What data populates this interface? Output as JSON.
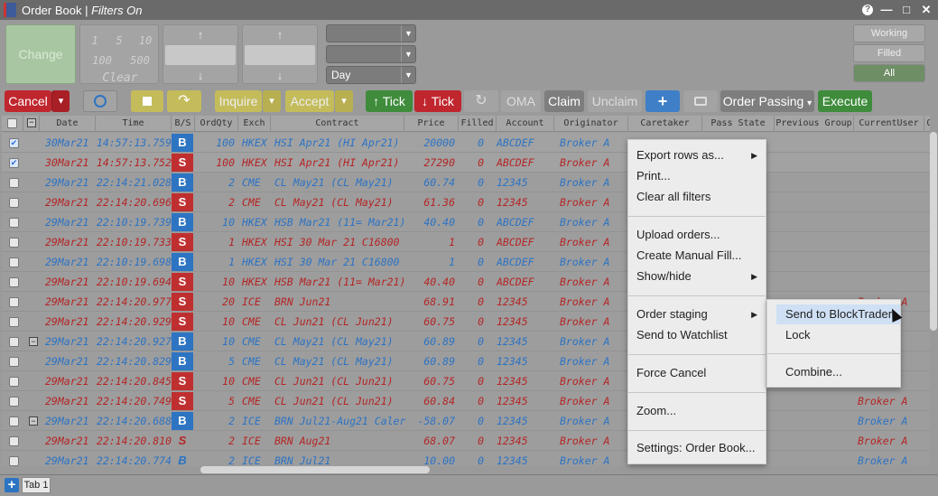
{
  "window": {
    "title_main": "Order Book | ",
    "title_italic": "Filters On",
    "buttons": [
      "?",
      "—",
      "□",
      "✕"
    ]
  },
  "toolbar": {
    "change_label": "Change",
    "qty_row1": [
      "1",
      "5",
      "10"
    ],
    "qty_row2": [
      "100",
      "500"
    ],
    "clear_label": "Clear",
    "up_arrow": "↑",
    "down_arrow": "↓",
    "dropdowns": [
      "",
      "",
      "Day"
    ],
    "caret": "▼",
    "right_tabs": [
      "Working",
      "Filled",
      "All"
    ]
  },
  "actions": {
    "cancel": "Cancel",
    "cancel_caret": "▾",
    "inquire": "Inquire",
    "accept": "Accept",
    "buy_tick": "↑ Tick",
    "sell_tick": "↓ Tick",
    "oma": "OMA",
    "claim": "Claim",
    "unclaim": "Unclaim",
    "plus": "+",
    "order_passing": "Order Passing",
    "execute": "Execute",
    "colors": {
      "cancel": "#c0262e",
      "buy": "#3f8c3c",
      "sell": "#c0262e",
      "execute": "#3f8c3c",
      "plus": "#2d74c2"
    }
  },
  "grid": {
    "headers": [
      "Date",
      "Time",
      "B/S",
      "OrdQty",
      "Exch",
      "Contract",
      "Price",
      "Filled",
      "Account",
      "Originator",
      "Caretaker",
      "Pass State",
      "Previous Group",
      "CurrentUser",
      "Or"
    ],
    "rows": [
      {
        "date": "30Mar21",
        "time": "14:57:13.759",
        "bs": "B",
        "qty": "100",
        "exch": "HKEX",
        "contract": "HSI Apr21 (HI Apr21)",
        "price": "20000",
        "filled": "0",
        "account": "ABCDEF",
        "orig": "Broker A",
        "current": "",
        "checked": true,
        "sel": true
      },
      {
        "date": "30Mar21",
        "time": "14:57:13.752",
        "bs": "S",
        "qty": "100",
        "exch": "HKEX",
        "contract": "HSI Apr21 (HI Apr21)",
        "price": "27290",
        "filled": "0",
        "account": "ABCDEF",
        "orig": "Broker A",
        "current": "",
        "checked": true,
        "sel": true
      },
      {
        "date": "29Mar21",
        "time": "22:14:21.028",
        "bs": "B",
        "qty": "2",
        "exch": "CME",
        "contract": "CL May21 (CL May21)",
        "price": "60.74",
        "filled": "0",
        "account": "12345",
        "orig": "Broker A",
        "current": "",
        "checked": false
      },
      {
        "date": "29Mar21",
        "time": "22:14:20.696",
        "bs": "S",
        "qty": "2",
        "exch": "CME",
        "contract": "CL May21 (CL May21)",
        "price": "61.36",
        "filled": "0",
        "account": "12345",
        "orig": "Broker A",
        "current": "",
        "checked": false
      },
      {
        "date": "29Mar21",
        "time": "22:10:19.739",
        "bs": "B",
        "qty": "10",
        "exch": "HKEX",
        "contract": "HSB Mar21 (11= Mar21)",
        "price": "40.40",
        "filled": "0",
        "account": "ABCDEF",
        "orig": "Broker A",
        "current": "",
        "checked": false
      },
      {
        "date": "29Mar21",
        "time": "22:10:19.733",
        "bs": "S",
        "qty": "1",
        "exch": "HKEX",
        "contract": "HSI 30 Mar 21 C16800",
        "price": "1",
        "filled": "0",
        "account": "ABCDEF",
        "orig": "Broker A",
        "current": "",
        "checked": false
      },
      {
        "date": "29Mar21",
        "time": "22:10:19.698",
        "bs": "B",
        "qty": "1",
        "exch": "HKEX",
        "contract": "HSI 30 Mar 21 C16800",
        "price": "1",
        "filled": "0",
        "account": "ABCDEF",
        "orig": "Broker A",
        "current": "",
        "checked": false
      },
      {
        "date": "29Mar21",
        "time": "22:10:19.694",
        "bs": "S",
        "qty": "10",
        "exch": "HKEX",
        "contract": "HSB Mar21 (11= Mar21)",
        "price": "40.40",
        "filled": "0",
        "account": "ABCDEF",
        "orig": "Broker A",
        "current": "",
        "checked": false
      },
      {
        "date": "29Mar21",
        "time": "22:14:20.977",
        "bs": "S",
        "qty": "20",
        "exch": "ICE",
        "contract": "BRN Jun21",
        "price": "68.91",
        "filled": "0",
        "account": "12345",
        "orig": "Broker A",
        "current": "",
        "checked": false
      },
      {
        "date": "29Mar21",
        "time": "22:14:20.929",
        "bs": "S",
        "qty": "10",
        "exch": "CME",
        "contract": "CL Jun21 (CL Jun21)",
        "price": "60.75",
        "filled": "0",
        "account": "12345",
        "orig": "Broker A",
        "current": "",
        "checked": false
      },
      {
        "date": "29Mar21",
        "time": "22:14:20.927",
        "bs": "B",
        "qty": "10",
        "exch": "CME",
        "contract": "CL May21 (CL May21)",
        "price": "60.89",
        "filled": "0",
        "account": "12345",
        "orig": "Broker A",
        "current": "",
        "checked": false,
        "expander": true
      },
      {
        "date": "29Mar21",
        "time": "22:14:20.829",
        "bs": "B",
        "qty": "5",
        "exch": "CME",
        "contract": "CL May21 (CL May21)",
        "price": "60.89",
        "filled": "0",
        "account": "12345",
        "orig": "Broker A",
        "current": "",
        "checked": false
      },
      {
        "date": "29Mar21",
        "time": "22:14:20.845",
        "bs": "S",
        "qty": "10",
        "exch": "CME",
        "contract": "CL Jun21 (CL Jun21)",
        "price": "60.75",
        "filled": "0",
        "account": "12345",
        "orig": "Broker A",
        "current": "",
        "checked": false
      },
      {
        "date": "29Mar21",
        "time": "22:14:20.749",
        "bs": "S",
        "qty": "5",
        "exch": "CME",
        "contract": "CL Jun21 (CL Jun21)",
        "price": "60.84",
        "filled": "0",
        "account": "12345",
        "orig": "Broker A",
        "current": "Broker A",
        "checked": false
      },
      {
        "date": "29Mar21",
        "time": "22:14:20.688",
        "bs": "B",
        "qty": "2",
        "exch": "ICE",
        "contract": "BRN Jul21-Aug21 Caler",
        "price": "-58.07",
        "filled": "0",
        "account": "12345",
        "orig": "Broker A",
        "current": "Broker A",
        "checked": false,
        "expander": true
      },
      {
        "date": "29Mar21",
        "time": "22:14:20.810",
        "bs": "S",
        "qty": "2",
        "exch": "ICE",
        "contract": "BRN Aug21",
        "price": "68.07",
        "filled": "0",
        "account": "12345",
        "orig": "Broker A",
        "current": "Broker A",
        "checked": false,
        "plain": true
      },
      {
        "date": "29Mar21",
        "time": "22:14:20.774",
        "bs": "B",
        "qty": "2",
        "exch": "ICE",
        "contract": "BRN Jul21",
        "price": "10.00",
        "filled": "0",
        "account": "12345",
        "orig": "Broker A",
        "current": "Broker A",
        "checked": false,
        "plain": true
      }
    ],
    "partial_right": "Broker A"
  },
  "context_menu": {
    "items": [
      "Export rows as...",
      "Print...",
      "Clear all filters",
      "Upload orders...",
      "Create Manual Fill...",
      "Show/hide",
      "Order staging",
      "Send to Watchlist",
      "Force Cancel",
      "Zoom...",
      "Settings: Order Book..."
    ],
    "submenu_arrow": "▶"
  },
  "submenu": {
    "items": [
      "Send to BlockTrader",
      "Lock",
      "Combine..."
    ]
  },
  "tabs": {
    "add": "+",
    "tab1": "Tab 1"
  }
}
